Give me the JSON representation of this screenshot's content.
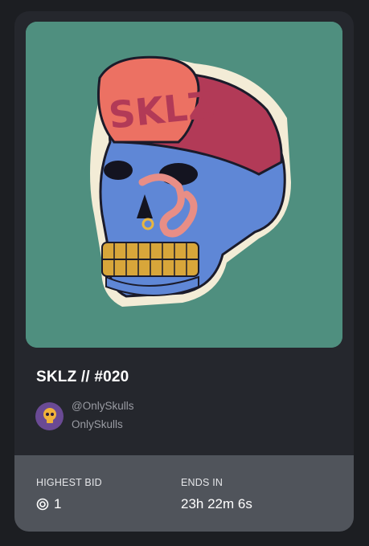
{
  "nft": {
    "title": "SKLZ // #020",
    "art_alt": "Blue skull wearing a red cap with SKLZ lettering and a worm through the nose"
  },
  "creator": {
    "handle": "@OnlySkulls",
    "name": "OnlySkulls"
  },
  "auction": {
    "bid_label": "HIGHEST BID",
    "bid_value": "1",
    "currency_icon": "coin-icon",
    "ends_label": "ENDS IN",
    "ends_value": "23h 22m 6s"
  },
  "colors": {
    "card_bg": "#25272d",
    "footer_bg": "#50545b",
    "art_bg": "#4f8f7f",
    "avatar_bg": "#6a4a94"
  }
}
